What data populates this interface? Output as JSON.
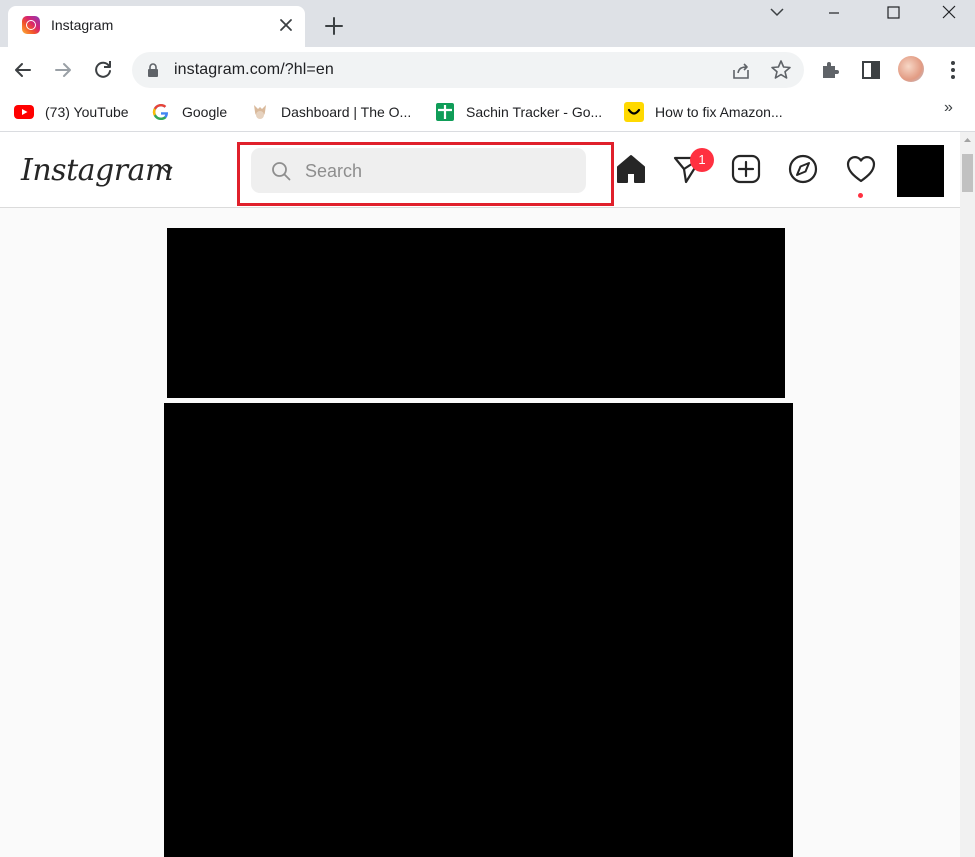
{
  "browser": {
    "tab_title": "Instagram",
    "url": "instagram.com/?hl=en",
    "bookmarks": [
      {
        "label": "(73) YouTube",
        "icon": "youtube-icon"
      },
      {
        "label": "Google",
        "icon": "google-icon"
      },
      {
        "label": "Dashboard | The O...",
        "icon": "dashboard-icon"
      },
      {
        "label": "Sachin Tracker - Go...",
        "icon": "sheets-icon"
      },
      {
        "label": "How to fix Amazon...",
        "icon": "bookmark-smile-icon"
      }
    ],
    "overflow_label": "»"
  },
  "instagram": {
    "logo": "Instagram",
    "search_placeholder": "Search",
    "messages_badge": "1",
    "nav_icons": [
      "home-icon",
      "direct-messages-icon",
      "new-post-icon",
      "explore-icon",
      "activity-heart-icon"
    ]
  },
  "colors": {
    "highlight": "#e0202b",
    "badge": "#ff3040",
    "tabstrip": "#dee1e6"
  }
}
